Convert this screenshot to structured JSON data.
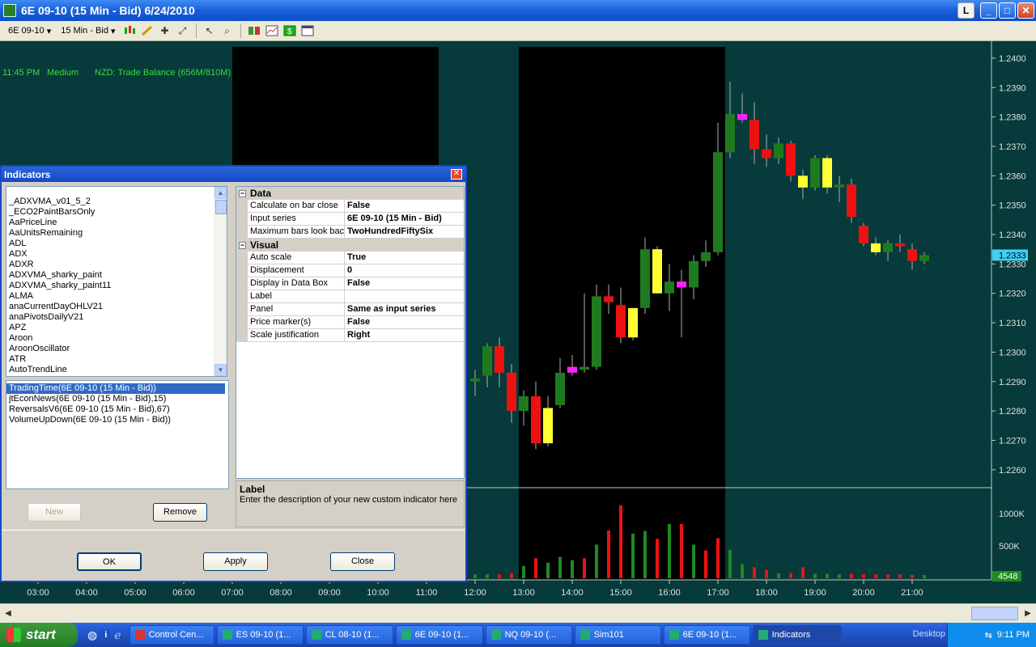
{
  "window": {
    "title": "6E 09-10 (15 Min - Bid)  6/24/2010",
    "btn_l": "L",
    "btn_min": "_",
    "btn_max": "□",
    "btn_close": "✕"
  },
  "toolbar": {
    "instrument": "6E 09-10",
    "interval": "15 Min - Bid"
  },
  "news": {
    "time": "11:45 PM",
    "impact": "Medium",
    "event": "NZD: Trade Balance (656M/810M)"
  },
  "colors": {
    "background": "#073a3a",
    "up": "#1f7a1f",
    "down": "#ee1111",
    "yellow": "#ffff33",
    "magenta": "#ff22ff",
    "price_marker": "#40d0f0"
  },
  "chart_data": {
    "type": "candlestick",
    "instrument": "6E 09-10",
    "price_axis": {
      "ticks": [
        "1.2400",
        "1.2390",
        "1.2380",
        "1.2370",
        "1.2360",
        "1.2350",
        "1.2340",
        "1.2330",
        "1.2320",
        "1.2310",
        "1.2300",
        "1.2290",
        "1.2280",
        "1.2270",
        "1.2260"
      ],
      "ylim": [
        1.2255,
        1.2403
      ],
      "current": "1.2333"
    },
    "volume_axis": {
      "ticks": [
        "1000K",
        "500K"
      ],
      "current": "4548",
      "ymax": 1300000
    },
    "time_axis": {
      "ticks": [
        "03:00",
        "04:00",
        "05:00",
        "06:00",
        "07:00",
        "08:00",
        "09:00",
        "10:00",
        "11:00",
        "12:00",
        "13:00",
        "14:00",
        "15:00",
        "16:00",
        "17:00",
        "18:00",
        "19:00",
        "20:00",
        "21:00"
      ],
      "hours": [
        3,
        4,
        5,
        6,
        7,
        8,
        9,
        10,
        11,
        12,
        13,
        14,
        15,
        16,
        17,
        18,
        19,
        20,
        21
      ]
    },
    "sessions": [
      [
        7.0,
        11.25
      ],
      [
        12.9,
        17.15
      ]
    ],
    "candles": [
      {
        "t": 12.0,
        "o": 1.2291,
        "h": 1.2294,
        "l": 1.2285,
        "c": 1.229,
        "col": "up"
      },
      {
        "t": 12.25,
        "o": 1.2292,
        "h": 1.2303,
        "l": 1.2288,
        "c": 1.2302,
        "col": "up"
      },
      {
        "t": 12.5,
        "o": 1.2302,
        "h": 1.2305,
        "l": 1.2288,
        "c": 1.2293,
        "col": "down"
      },
      {
        "t": 12.75,
        "o": 1.2293,
        "h": 1.2296,
        "l": 1.2276,
        "c": 1.228,
        "col": "down"
      },
      {
        "t": 13.0,
        "o": 1.228,
        "h": 1.2287,
        "l": 1.2275,
        "c": 1.2285,
        "col": "up"
      },
      {
        "t": 13.25,
        "o": 1.2285,
        "h": 1.229,
        "l": 1.2267,
        "c": 1.2269,
        "col": "down"
      },
      {
        "t": 13.5,
        "o": 1.2269,
        "h": 1.2285,
        "l": 1.2268,
        "c": 1.2281,
        "col": "yellow"
      },
      {
        "t": 13.75,
        "o": 1.2282,
        "h": 1.2298,
        "l": 1.2281,
        "c": 1.2293,
        "col": "up"
      },
      {
        "t": 14.0,
        "o": 1.2293,
        "h": 1.2299,
        "l": 1.2292,
        "c": 1.2295,
        "col": "magenta"
      },
      {
        "t": 14.25,
        "o": 1.2294,
        "h": 1.232,
        "l": 1.2293,
        "c": 1.2295,
        "col": "up"
      },
      {
        "t": 14.5,
        "o": 1.2295,
        "h": 1.2323,
        "l": 1.2294,
        "c": 1.2319,
        "col": "up"
      },
      {
        "t": 14.75,
        "o": 1.2319,
        "h": 1.2323,
        "l": 1.2313,
        "c": 1.2317,
        "col": "down"
      },
      {
        "t": 15.0,
        "o": 1.2316,
        "h": 1.2322,
        "l": 1.2303,
        "c": 1.2305,
        "col": "down"
      },
      {
        "t": 15.25,
        "o": 1.2305,
        "h": 1.2315,
        "l": 1.2304,
        "c": 1.2315,
        "col": "yellow"
      },
      {
        "t": 15.5,
        "o": 1.2315,
        "h": 1.2339,
        "l": 1.2313,
        "c": 1.2335,
        "col": "up"
      },
      {
        "t": 15.75,
        "o": 1.2335,
        "h": 1.2336,
        "l": 1.232,
        "c": 1.232,
        "col": "yellow"
      },
      {
        "t": 16.0,
        "o": 1.232,
        "h": 1.233,
        "l": 1.2314,
        "c": 1.2324,
        "col": "up"
      },
      {
        "t": 16.25,
        "o": 1.2324,
        "h": 1.2328,
        "l": 1.2305,
        "c": 1.2322,
        "col": "magenta"
      },
      {
        "t": 16.5,
        "o": 1.2322,
        "h": 1.2333,
        "l": 1.2318,
        "c": 1.2331,
        "col": "up"
      },
      {
        "t": 16.75,
        "o": 1.2331,
        "h": 1.2338,
        "l": 1.2329,
        "c": 1.2334,
        "col": "up"
      },
      {
        "t": 17.0,
        "o": 1.2334,
        "h": 1.2378,
        "l": 1.2333,
        "c": 1.2368,
        "col": "up"
      },
      {
        "t": 17.25,
        "o": 1.2368,
        "h": 1.2392,
        "l": 1.2366,
        "c": 1.2381,
        "col": "up"
      },
      {
        "t": 17.5,
        "o": 1.2381,
        "h": 1.2388,
        "l": 1.2378,
        "c": 1.2379,
        "col": "magenta"
      },
      {
        "t": 17.75,
        "o": 1.2379,
        "h": 1.2385,
        "l": 1.2364,
        "c": 1.2369,
        "col": "down"
      },
      {
        "t": 18.0,
        "o": 1.2369,
        "h": 1.2374,
        "l": 1.2363,
        "c": 1.2366,
        "col": "down"
      },
      {
        "t": 18.25,
        "o": 1.2366,
        "h": 1.2373,
        "l": 1.2364,
        "c": 1.2371,
        "col": "up"
      },
      {
        "t": 18.5,
        "o": 1.2371,
        "h": 1.2372,
        "l": 1.2358,
        "c": 1.236,
        "col": "down"
      },
      {
        "t": 18.75,
        "o": 1.236,
        "h": 1.2362,
        "l": 1.2352,
        "c": 1.2356,
        "col": "yellow"
      },
      {
        "t": 19.0,
        "o": 1.2356,
        "h": 1.2367,
        "l": 1.2355,
        "c": 1.2366,
        "col": "up"
      },
      {
        "t": 19.25,
        "o": 1.2366,
        "h": 1.2367,
        "l": 1.2354,
        "c": 1.2356,
        "col": "yellow"
      },
      {
        "t": 19.5,
        "o": 1.2356,
        "h": 1.236,
        "l": 1.2351,
        "c": 1.2357,
        "col": "up"
      },
      {
        "t": 19.75,
        "o": 1.2357,
        "h": 1.2359,
        "l": 1.2344,
        "c": 1.2346,
        "col": "down"
      },
      {
        "t": 20.0,
        "o": 1.2343,
        "h": 1.2344,
        "l": 1.2336,
        "c": 1.2337,
        "col": "down"
      },
      {
        "t": 20.25,
        "o": 1.2337,
        "h": 1.2339,
        "l": 1.2333,
        "c": 1.2334,
        "col": "yellow"
      },
      {
        "t": 20.5,
        "o": 1.2334,
        "h": 1.2338,
        "l": 1.2331,
        "c": 1.2337,
        "col": "up"
      },
      {
        "t": 20.75,
        "o": 1.2337,
        "h": 1.234,
        "l": 1.2334,
        "c": 1.2336,
        "col": "down"
      },
      {
        "t": 21.0,
        "o": 1.2335,
        "h": 1.2337,
        "l": 1.2328,
        "c": 1.2331,
        "col": "down"
      },
      {
        "t": 21.25,
        "o": 1.2331,
        "h": 1.2334,
        "l": 1.233,
        "c": 1.2333,
        "col": "up"
      }
    ],
    "volume": [
      {
        "t": 12.0,
        "v": 60000,
        "col": "up"
      },
      {
        "t": 12.25,
        "v": 60000,
        "col": "up"
      },
      {
        "t": 12.5,
        "v": 60000,
        "col": "down"
      },
      {
        "t": 12.75,
        "v": 80000,
        "col": "down"
      },
      {
        "t": 13.0,
        "v": 190000,
        "col": "up"
      },
      {
        "t": 13.25,
        "v": 310000,
        "col": "down"
      },
      {
        "t": 13.5,
        "v": 240000,
        "col": "up"
      },
      {
        "t": 13.75,
        "v": 330000,
        "col": "up"
      },
      {
        "t": 14.0,
        "v": 280000,
        "col": "up"
      },
      {
        "t": 14.25,
        "v": 310000,
        "col": "down"
      },
      {
        "t": 14.5,
        "v": 520000,
        "col": "up"
      },
      {
        "t": 14.75,
        "v": 740000,
        "col": "down"
      },
      {
        "t": 15.0,
        "v": 1130000,
        "col": "down"
      },
      {
        "t": 15.25,
        "v": 690000,
        "col": "up"
      },
      {
        "t": 15.5,
        "v": 730000,
        "col": "up"
      },
      {
        "t": 15.75,
        "v": 610000,
        "col": "down"
      },
      {
        "t": 16.0,
        "v": 840000,
        "col": "up"
      },
      {
        "t": 16.25,
        "v": 840000,
        "col": "down"
      },
      {
        "t": 16.5,
        "v": 520000,
        "col": "up"
      },
      {
        "t": 16.75,
        "v": 430000,
        "col": "down"
      },
      {
        "t": 17.0,
        "v": 620000,
        "col": "down"
      },
      {
        "t": 17.25,
        "v": 440000,
        "col": "up"
      },
      {
        "t": 17.5,
        "v": 220000,
        "col": "up"
      },
      {
        "t": 17.75,
        "v": 170000,
        "col": "down"
      },
      {
        "t": 18.0,
        "v": 130000,
        "col": "down"
      },
      {
        "t": 18.25,
        "v": 80000,
        "col": "up"
      },
      {
        "t": 18.5,
        "v": 80000,
        "col": "down"
      },
      {
        "t": 18.75,
        "v": 170000,
        "col": "down"
      },
      {
        "t": 19.0,
        "v": 70000,
        "col": "up"
      },
      {
        "t": 19.25,
        "v": 70000,
        "col": "up"
      },
      {
        "t": 19.5,
        "v": 60000,
        "col": "up"
      },
      {
        "t": 19.75,
        "v": 70000,
        "col": "down"
      },
      {
        "t": 20.0,
        "v": 60000,
        "col": "down"
      },
      {
        "t": 20.25,
        "v": 60000,
        "col": "down"
      },
      {
        "t": 20.5,
        "v": 60000,
        "col": "down"
      },
      {
        "t": 20.75,
        "v": 60000,
        "col": "down"
      },
      {
        "t": 21.0,
        "v": 50000,
        "col": "down"
      },
      {
        "t": 21.25,
        "v": 50000,
        "col": "up"
      }
    ]
  },
  "dialog": {
    "title": "Indicators",
    "available": [
      "_ADXVMA_v01_5_2",
      "_ECO2PaintBarsOnly",
      "AaPriceLine",
      "AaUnitsRemaining",
      "ADL",
      "ADX",
      "ADXR",
      "ADXVMA_sharky_paint",
      "ADXVMA_sharky_paint11",
      "ALMA",
      "anaCurrentDayOHLV21",
      "anaPivotsDailyV21",
      "APZ",
      "Aroon",
      "AroonOscillator",
      "ATR",
      "AutoTrendLine"
    ],
    "applied": [
      "TradingTime(6E 09-10 (15 Min - Bid))",
      "jtEconNews(6E 09-10 (15 Min - Bid),15)",
      "ReversalsV6(6E 09-10 (15 Min - Bid),67)",
      "VolumeUpDown(6E 09-10 (15 Min - Bid))"
    ],
    "props": {
      "cat_data": "Data",
      "cat_visual": "Visual",
      "data_rows": [
        {
          "name": "Calculate on bar close",
          "value": "False"
        },
        {
          "name": "Input series",
          "value": "6E 09-10 (15 Min - Bid)"
        },
        {
          "name": "Maximum bars look back",
          "value": "TwoHundredFiftySix"
        }
      ],
      "visual_rows": [
        {
          "name": "Auto scale",
          "value": "True"
        },
        {
          "name": "Displacement",
          "value": "0"
        },
        {
          "name": "Display in Data Box",
          "value": "False"
        },
        {
          "name": "Label",
          "value": ""
        },
        {
          "name": "Panel",
          "value": "Same as input series"
        },
        {
          "name": "Price marker(s)",
          "value": "False"
        },
        {
          "name": "Scale justification",
          "value": "Right"
        }
      ]
    },
    "help_title": "Label",
    "help_text": "Enter the description of your new custom indicator here",
    "new_label": "New",
    "remove_label": "Remove",
    "ok_label": "OK",
    "apply_label": "Apply",
    "close_label": "Close"
  },
  "taskbar": {
    "start": "start",
    "tasks": [
      "Control Cen...",
      "ES 09-10 (1...",
      "CL 08-10 (1...",
      "6E 09-10 (1...",
      "NQ 09-10 (...",
      "Sim101",
      "6E 09-10 (1...",
      "Indicators"
    ],
    "desktop": "Desktop",
    "clock": "9:11 PM"
  }
}
